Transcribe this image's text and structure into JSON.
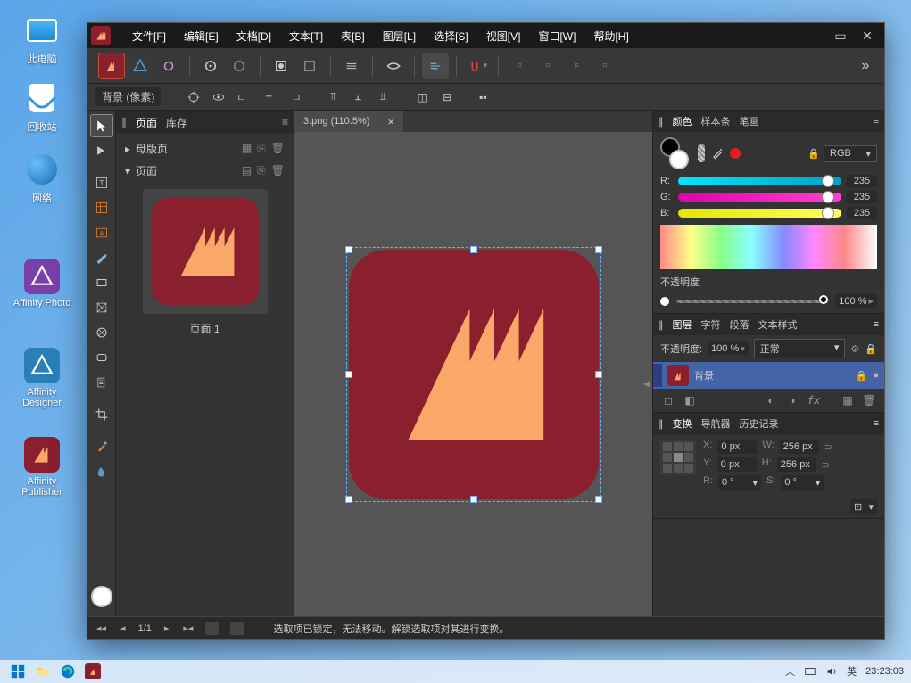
{
  "desktop": {
    "icons": [
      {
        "label": "此电脑"
      },
      {
        "label": "回收站"
      },
      {
        "label": "网络"
      },
      {
        "label": "Affinity Photo"
      },
      {
        "label": "Affinity Designer"
      },
      {
        "label": "Affinity Publisher"
      }
    ]
  },
  "menu": {
    "file": "文件[F]",
    "edit": "编辑[E]",
    "doc": "文档[D]",
    "text": "文本[T]",
    "table": "表[B]",
    "layer": "图层[L]",
    "select": "选择[S]",
    "view": "视图[V]",
    "window": "窗口[W]",
    "help": "帮助[H]"
  },
  "contextLabel": "背景 (像素)",
  "docTab": {
    "title": "3.png (110.5%)"
  },
  "pagesPanel": {
    "tabPages": "页面",
    "tabLibrary": "库存",
    "master": "母版页",
    "pages": "页面",
    "page1": "页面 1"
  },
  "colorPanel": {
    "tabColor": "颜色",
    "tabSwatches": "样本条",
    "tabBrush": "笔画",
    "mode": "RGB",
    "r": {
      "lbl": "R:",
      "val": "235"
    },
    "g": {
      "lbl": "G:",
      "val": "235"
    },
    "b": {
      "lbl": "B:",
      "val": "235"
    },
    "opacityLabel": "不透明度",
    "opacityVal": "100 %"
  },
  "layersPanel": {
    "tabLayers": "图层",
    "tabChar": "字符",
    "tabPara": "段落",
    "tabTextStyle": "文本样式",
    "opacityLabel": "不透明度:",
    "opacityVal": "100 %",
    "blend": "正常",
    "layerName": "背景"
  },
  "transformPanel": {
    "tabTransform": "变换",
    "tabNav": "导航器",
    "tabHistory": "历史记录",
    "x": {
      "lbl": "X:",
      "val": "0 px"
    },
    "y": {
      "lbl": "Y:",
      "val": "0 px"
    },
    "w": {
      "lbl": "W:",
      "val": "256 px"
    },
    "h": {
      "lbl": "H:",
      "val": "256 px"
    },
    "r": {
      "lbl": "R:",
      "val": "0 °"
    },
    "s": {
      "lbl": "S:",
      "val": "0 °"
    }
  },
  "status": {
    "page": "1/1",
    "msg": "选取项已锁定，无法移动。解锁选取项对其进行变换。"
  },
  "taskbar": {
    "ime": "英",
    "time": "23:23:03"
  }
}
